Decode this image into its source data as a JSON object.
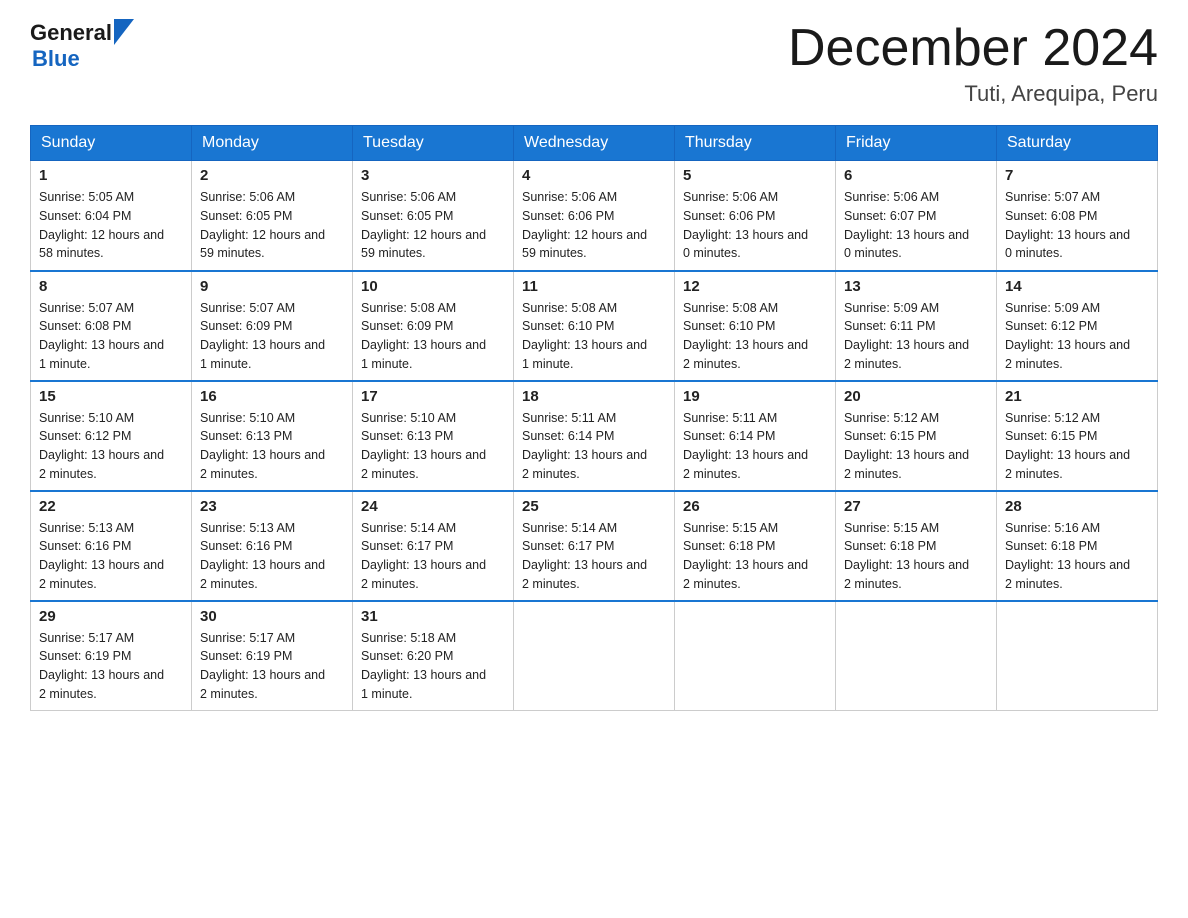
{
  "header": {
    "logo_general": "General",
    "logo_blue": "Blue",
    "month_year": "December 2024",
    "location": "Tuti, Arequipa, Peru"
  },
  "days_of_week": [
    "Sunday",
    "Monday",
    "Tuesday",
    "Wednesday",
    "Thursday",
    "Friday",
    "Saturday"
  ],
  "weeks": [
    [
      {
        "day": "1",
        "sunrise": "5:05 AM",
        "sunset": "6:04 PM",
        "daylight": "12 hours and 58 minutes."
      },
      {
        "day": "2",
        "sunrise": "5:06 AM",
        "sunset": "6:05 PM",
        "daylight": "12 hours and 59 minutes."
      },
      {
        "day": "3",
        "sunrise": "5:06 AM",
        "sunset": "6:05 PM",
        "daylight": "12 hours and 59 minutes."
      },
      {
        "day": "4",
        "sunrise": "5:06 AM",
        "sunset": "6:06 PM",
        "daylight": "12 hours and 59 minutes."
      },
      {
        "day": "5",
        "sunrise": "5:06 AM",
        "sunset": "6:06 PM",
        "daylight": "13 hours and 0 minutes."
      },
      {
        "day": "6",
        "sunrise": "5:06 AM",
        "sunset": "6:07 PM",
        "daylight": "13 hours and 0 minutes."
      },
      {
        "day": "7",
        "sunrise": "5:07 AM",
        "sunset": "6:08 PM",
        "daylight": "13 hours and 0 minutes."
      }
    ],
    [
      {
        "day": "8",
        "sunrise": "5:07 AM",
        "sunset": "6:08 PM",
        "daylight": "13 hours and 1 minute."
      },
      {
        "day": "9",
        "sunrise": "5:07 AM",
        "sunset": "6:09 PM",
        "daylight": "13 hours and 1 minute."
      },
      {
        "day": "10",
        "sunrise": "5:08 AM",
        "sunset": "6:09 PM",
        "daylight": "13 hours and 1 minute."
      },
      {
        "day": "11",
        "sunrise": "5:08 AM",
        "sunset": "6:10 PM",
        "daylight": "13 hours and 1 minute."
      },
      {
        "day": "12",
        "sunrise": "5:08 AM",
        "sunset": "6:10 PM",
        "daylight": "13 hours and 2 minutes."
      },
      {
        "day": "13",
        "sunrise": "5:09 AM",
        "sunset": "6:11 PM",
        "daylight": "13 hours and 2 minutes."
      },
      {
        "day": "14",
        "sunrise": "5:09 AM",
        "sunset": "6:12 PM",
        "daylight": "13 hours and 2 minutes."
      }
    ],
    [
      {
        "day": "15",
        "sunrise": "5:10 AM",
        "sunset": "6:12 PM",
        "daylight": "13 hours and 2 minutes."
      },
      {
        "day": "16",
        "sunrise": "5:10 AM",
        "sunset": "6:13 PM",
        "daylight": "13 hours and 2 minutes."
      },
      {
        "day": "17",
        "sunrise": "5:10 AM",
        "sunset": "6:13 PM",
        "daylight": "13 hours and 2 minutes."
      },
      {
        "day": "18",
        "sunrise": "5:11 AM",
        "sunset": "6:14 PM",
        "daylight": "13 hours and 2 minutes."
      },
      {
        "day": "19",
        "sunrise": "5:11 AM",
        "sunset": "6:14 PM",
        "daylight": "13 hours and 2 minutes."
      },
      {
        "day": "20",
        "sunrise": "5:12 AM",
        "sunset": "6:15 PM",
        "daylight": "13 hours and 2 minutes."
      },
      {
        "day": "21",
        "sunrise": "5:12 AM",
        "sunset": "6:15 PM",
        "daylight": "13 hours and 2 minutes."
      }
    ],
    [
      {
        "day": "22",
        "sunrise": "5:13 AM",
        "sunset": "6:16 PM",
        "daylight": "13 hours and 2 minutes."
      },
      {
        "day": "23",
        "sunrise": "5:13 AM",
        "sunset": "6:16 PM",
        "daylight": "13 hours and 2 minutes."
      },
      {
        "day": "24",
        "sunrise": "5:14 AM",
        "sunset": "6:17 PM",
        "daylight": "13 hours and 2 minutes."
      },
      {
        "day": "25",
        "sunrise": "5:14 AM",
        "sunset": "6:17 PM",
        "daylight": "13 hours and 2 minutes."
      },
      {
        "day": "26",
        "sunrise": "5:15 AM",
        "sunset": "6:18 PM",
        "daylight": "13 hours and 2 minutes."
      },
      {
        "day": "27",
        "sunrise": "5:15 AM",
        "sunset": "6:18 PM",
        "daylight": "13 hours and 2 minutes."
      },
      {
        "day": "28",
        "sunrise": "5:16 AM",
        "sunset": "6:18 PM",
        "daylight": "13 hours and 2 minutes."
      }
    ],
    [
      {
        "day": "29",
        "sunrise": "5:17 AM",
        "sunset": "6:19 PM",
        "daylight": "13 hours and 2 minutes."
      },
      {
        "day": "30",
        "sunrise": "5:17 AM",
        "sunset": "6:19 PM",
        "daylight": "13 hours and 2 minutes."
      },
      {
        "day": "31",
        "sunrise": "5:18 AM",
        "sunset": "6:20 PM",
        "daylight": "13 hours and 1 minute."
      },
      null,
      null,
      null,
      null
    ]
  ],
  "labels": {
    "sunrise": "Sunrise:",
    "sunset": "Sunset:",
    "daylight": "Daylight:"
  }
}
